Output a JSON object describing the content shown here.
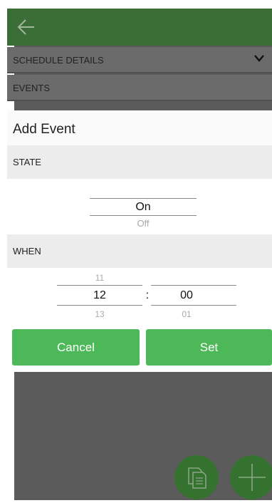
{
  "colors": {
    "topbar": "#3b6e37",
    "accent_button": "#4cb857",
    "fab": "#36722f",
    "overlay_bg": "#5b5b5b"
  },
  "header": {
    "back_icon": "arrow-left-icon"
  },
  "background": {
    "schedule_details_label": "SCHEDULE DETAILS",
    "events_label": "EVENTS"
  },
  "dialog": {
    "title": "Add Event",
    "state": {
      "label": "STATE",
      "selected": "On",
      "next": "Off"
    },
    "when": {
      "label": "WHEN",
      "hour": {
        "prev": "11",
        "selected": "12",
        "next": "13"
      },
      "separator": ":",
      "minute": {
        "selected": "00",
        "next": "01"
      }
    },
    "cancel_label": "Cancel",
    "set_label": "Set"
  },
  "fabs": [
    {
      "icon": "copy-icon"
    },
    {
      "icon": "add-icon"
    }
  ]
}
